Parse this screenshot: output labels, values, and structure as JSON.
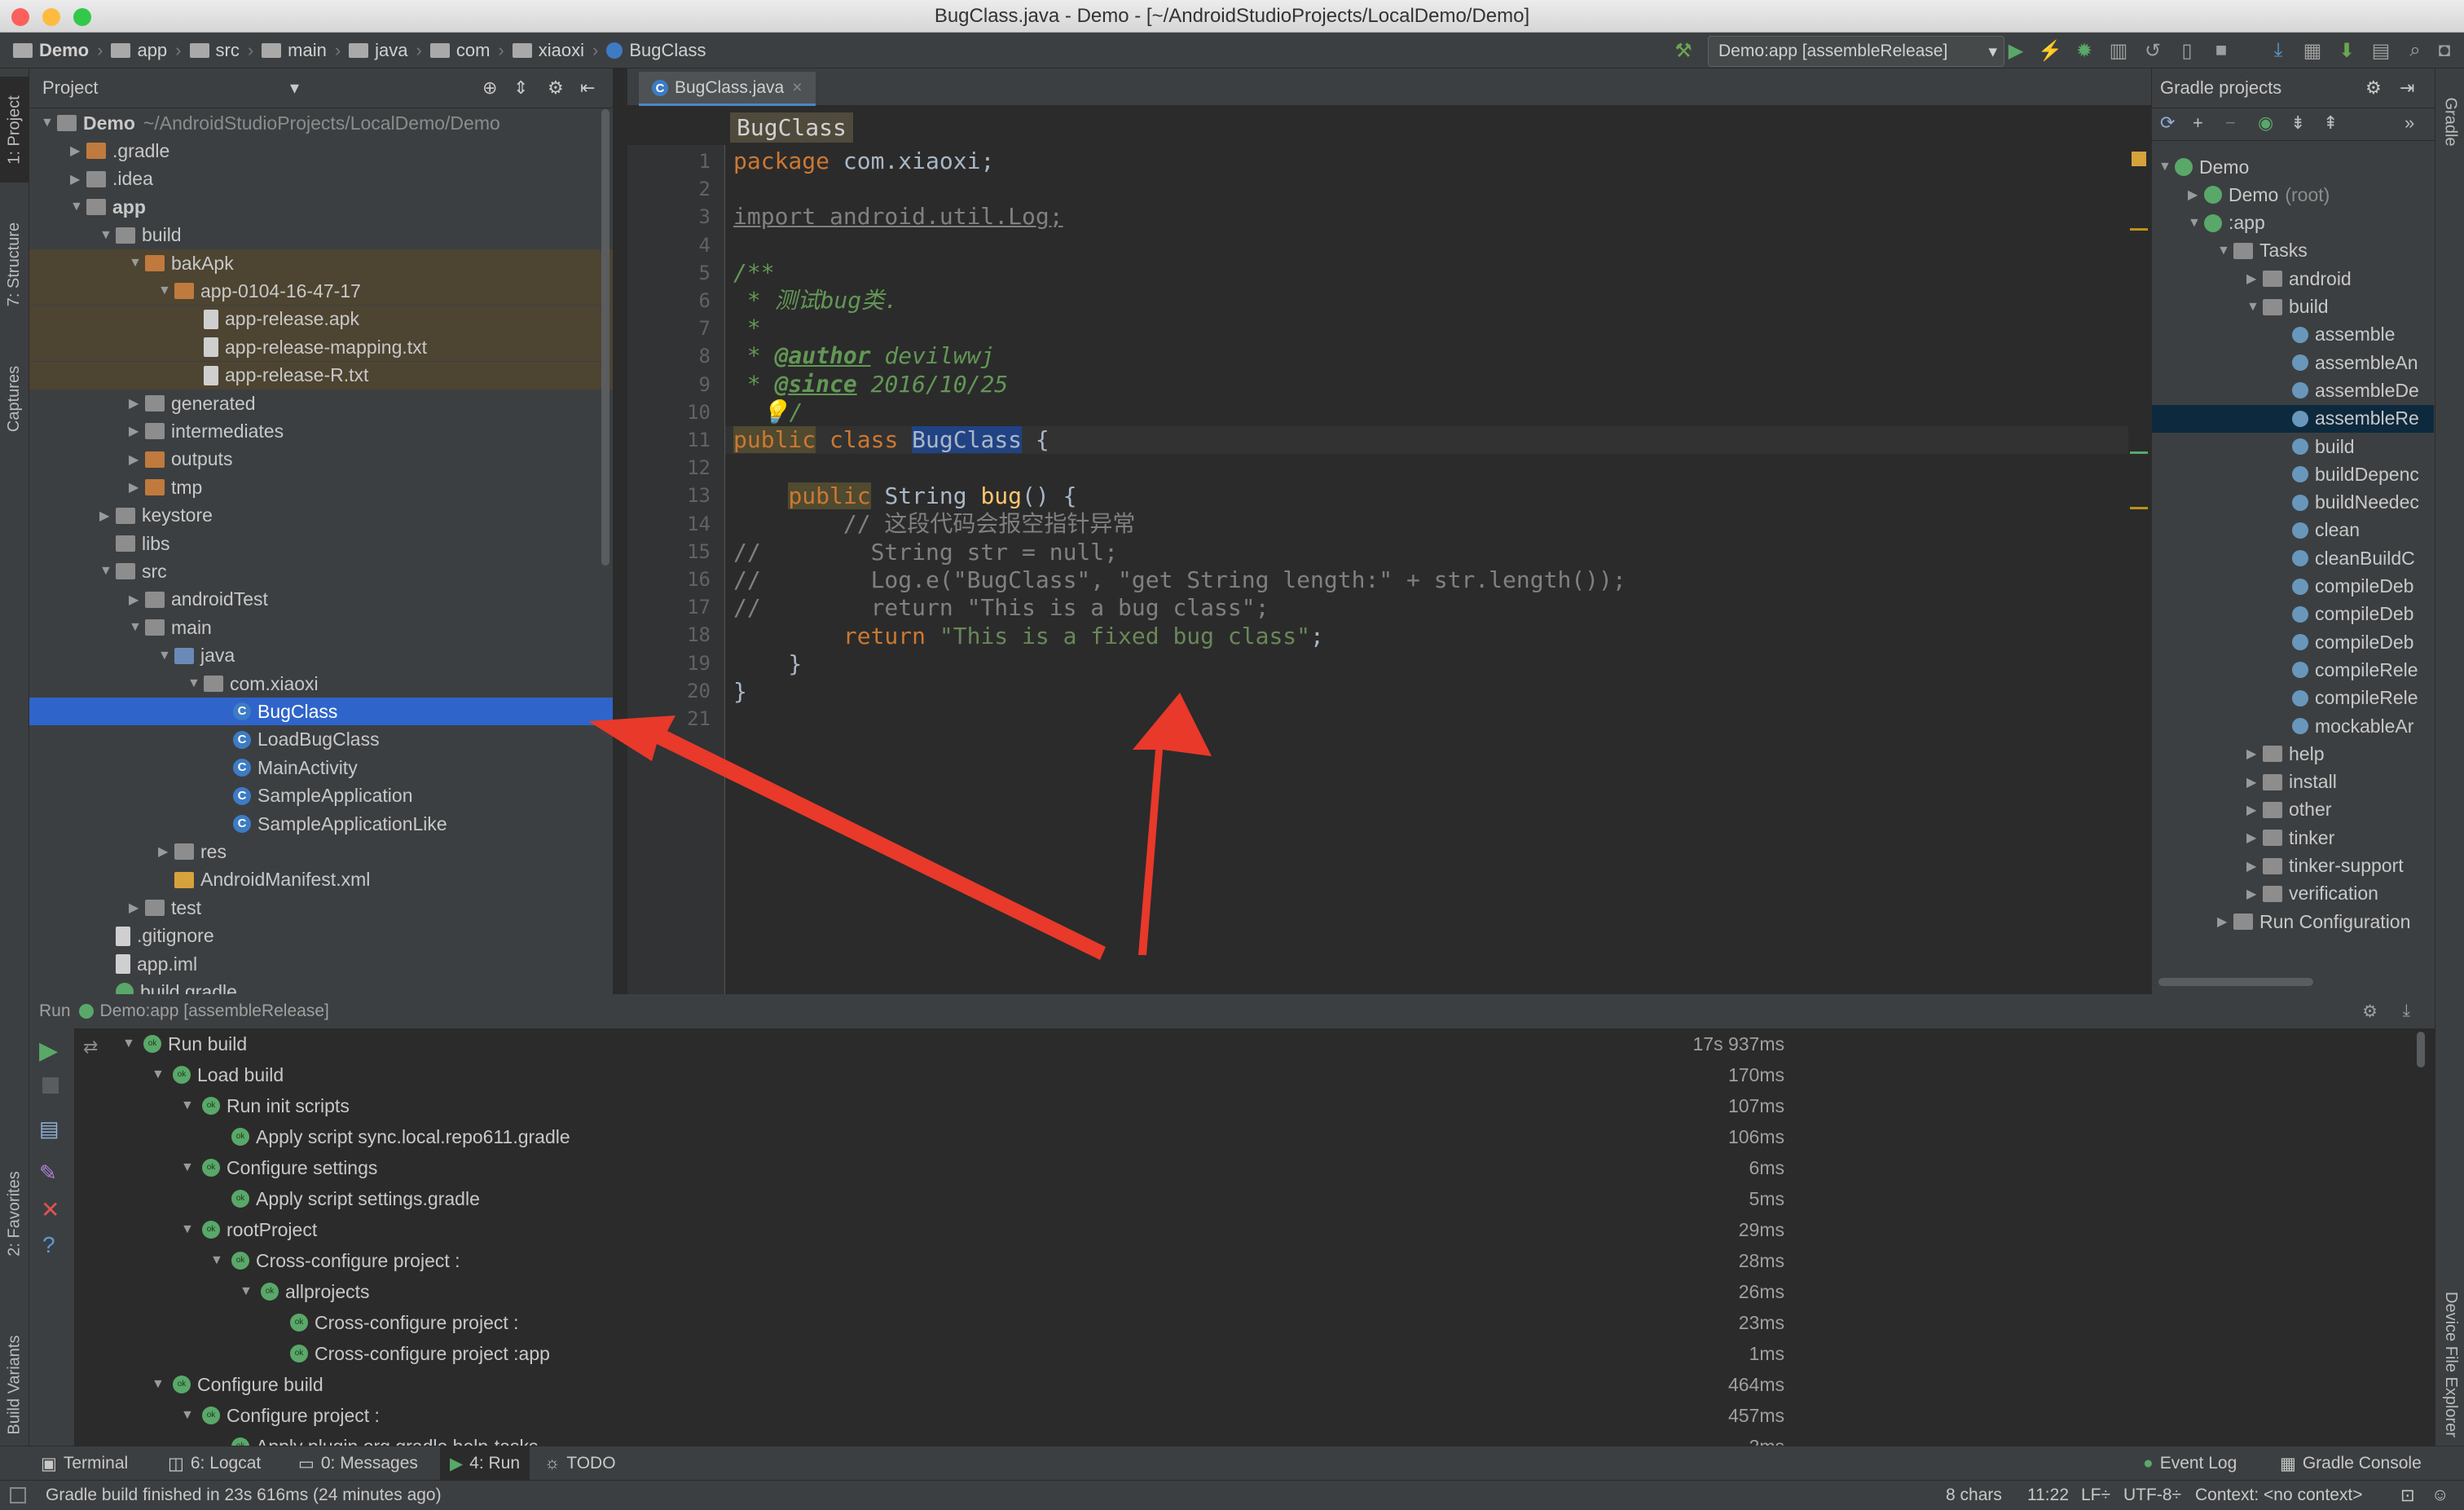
{
  "window": {
    "title": "BugClass.java - Demo - [~/AndroidStudioProjects/LocalDemo/Demo]"
  },
  "navbar": {
    "breadcrumbs": [
      "Demo",
      "app",
      "src",
      "main",
      "java",
      "com",
      "xiaoxi",
      "BugClass"
    ],
    "run_config": "Demo:app [assembleRelease]"
  },
  "left_strip": {
    "tabs": [
      "1: Project",
      "7: Structure",
      "Captures",
      "2: Favorites",
      "Build Variants"
    ]
  },
  "right_strip": {
    "tabs": [
      "Gradle",
      "Device File Explorer"
    ]
  },
  "project": {
    "header": "Project",
    "items": [
      {
        "label": "Demo",
        "suffix": "~/AndroidStudioProjects/LocalDemo/Demo",
        "depth": 0,
        "arrow": "▼",
        "icon": "folder"
      },
      {
        "label": ".gradle",
        "depth": 1,
        "arrow": "▶",
        "icon": "folder-o"
      },
      {
        "label": ".idea",
        "depth": 1,
        "arrow": "▶",
        "icon": "folder"
      },
      {
        "label": "app",
        "depth": 1,
        "arrow": "▼",
        "icon": "folder"
      },
      {
        "label": "build",
        "depth": 2,
        "arrow": "▼",
        "icon": "folder"
      },
      {
        "label": "bakApk",
        "depth": 3,
        "arrow": "▼",
        "icon": "folder-o"
      },
      {
        "label": "app-0104-16-47-17",
        "depth": 4,
        "arrow": "▼",
        "icon": "folder-o"
      },
      {
        "label": "app-release.apk",
        "depth": 5,
        "arrow": "",
        "icon": "file"
      },
      {
        "label": "app-release-mapping.txt",
        "depth": 5,
        "arrow": "",
        "icon": "file"
      },
      {
        "label": "app-release-R.txt",
        "depth": 5,
        "arrow": "",
        "icon": "file"
      },
      {
        "label": "generated",
        "depth": 3,
        "arrow": "▶",
        "icon": "folder"
      },
      {
        "label": "intermediates",
        "depth": 3,
        "arrow": "▶",
        "icon": "folder"
      },
      {
        "label": "outputs",
        "depth": 3,
        "arrow": "▶",
        "icon": "folder-o"
      },
      {
        "label": "tmp",
        "depth": 3,
        "arrow": "▶",
        "icon": "folder-o"
      },
      {
        "label": "keystore",
        "depth": 2,
        "arrow": "▶",
        "icon": "folder"
      },
      {
        "label": "libs",
        "depth": 2,
        "arrow": "",
        "icon": "folder"
      },
      {
        "label": "src",
        "depth": 2,
        "arrow": "▼",
        "icon": "folder"
      },
      {
        "label": "androidTest",
        "depth": 3,
        "arrow": "▶",
        "icon": "folder"
      },
      {
        "label": "main",
        "depth": 3,
        "arrow": "▼",
        "icon": "folder"
      },
      {
        "label": "java",
        "depth": 4,
        "arrow": "▼",
        "icon": "folder-b"
      },
      {
        "label": "com.xiaoxi",
        "depth": 5,
        "arrow": "▼",
        "icon": "folder"
      },
      {
        "label": "BugClass",
        "depth": 6,
        "arrow": "",
        "icon": "class",
        "selected": true
      },
      {
        "label": "LoadBugClass",
        "depth": 6,
        "arrow": "",
        "icon": "class"
      },
      {
        "label": "MainActivity",
        "depth": 6,
        "arrow": "",
        "icon": "class"
      },
      {
        "label": "SampleApplication",
        "depth": 6,
        "arrow": "",
        "icon": "class"
      },
      {
        "label": "SampleApplicationLike",
        "depth": 6,
        "arrow": "",
        "icon": "class"
      },
      {
        "label": "res",
        "depth": 4,
        "arrow": "▶",
        "icon": "folder"
      },
      {
        "label": "AndroidManifest.xml",
        "depth": 4,
        "arrow": "",
        "icon": "xml"
      },
      {
        "label": "test",
        "depth": 3,
        "arrow": "▶",
        "icon": "folder"
      },
      {
        "label": ".gitignore",
        "depth": 2,
        "arrow": "",
        "icon": "file"
      },
      {
        "label": "app.iml",
        "depth": 2,
        "arrow": "",
        "icon": "file"
      },
      {
        "label": "build.gradle",
        "depth": 2,
        "arrow": "",
        "icon": "gradle"
      }
    ]
  },
  "editor": {
    "tab": "BugClass.java",
    "context": "BugClass",
    "line_numbers": [
      "1",
      "2",
      "3",
      "4",
      "5",
      "6",
      "7",
      "8",
      "9",
      "10",
      "11",
      "12",
      "13",
      "14",
      "15",
      "16",
      "17",
      "18",
      "19",
      "20",
      "21"
    ]
  },
  "gradle_panel": {
    "header": "Gradle projects",
    "items": [
      {
        "label": "Demo",
        "suffix": "",
        "depth": 0,
        "arrow": "▼",
        "icon": "gradle"
      },
      {
        "label": "Demo",
        "suffix": "(root)",
        "depth": 1,
        "arrow": "▶",
        "icon": "gradle"
      },
      {
        "label": ":app",
        "suffix": "",
        "depth": 1,
        "arrow": "▼",
        "icon": "gradle"
      },
      {
        "label": "Tasks",
        "suffix": "",
        "depth": 2,
        "arrow": "▼",
        "icon": "folder"
      },
      {
        "label": "android",
        "suffix": "",
        "depth": 3,
        "arrow": "▶",
        "icon": "folder"
      },
      {
        "label": "build",
        "suffix": "",
        "depth": 3,
        "arrow": "▼",
        "icon": "folder"
      },
      {
        "label": "assemble",
        "suffix": "",
        "depth": 4,
        "arrow": "",
        "icon": "gear"
      },
      {
        "label": "assembleAn",
        "suffix": "",
        "depth": 4,
        "arrow": "",
        "icon": "gear"
      },
      {
        "label": "assembleDe",
        "suffix": "",
        "depth": 4,
        "arrow": "",
        "icon": "gear"
      },
      {
        "label": "assembleRe",
        "suffix": "",
        "depth": 4,
        "arrow": "",
        "icon": "gear",
        "selected": true
      },
      {
        "label": "build",
        "suffix": "",
        "depth": 4,
        "arrow": "",
        "icon": "gear"
      },
      {
        "label": "buildDepenc",
        "suffix": "",
        "depth": 4,
        "arrow": "",
        "icon": "gear"
      },
      {
        "label": "buildNeedec",
        "suffix": "",
        "depth": 4,
        "arrow": "",
        "icon": "gear"
      },
      {
        "label": "clean",
        "suffix": "",
        "depth": 4,
        "arrow": "",
        "icon": "gear"
      },
      {
        "label": "cleanBuildC",
        "suffix": "",
        "depth": 4,
        "arrow": "",
        "icon": "gear"
      },
      {
        "label": "compileDeb",
        "suffix": "",
        "depth": 4,
        "arrow": "",
        "icon": "gear"
      },
      {
        "label": "compileDeb",
        "suffix": "",
        "depth": 4,
        "arrow": "",
        "icon": "gear"
      },
      {
        "label": "compileDeb",
        "suffix": "",
        "depth": 4,
        "arrow": "",
        "icon": "gear"
      },
      {
        "label": "compileRele",
        "suffix": "",
        "depth": 4,
        "arrow": "",
        "icon": "gear"
      },
      {
        "label": "compileRele",
        "suffix": "",
        "depth": 4,
        "arrow": "",
        "icon": "gear"
      },
      {
        "label": "mockableAr",
        "suffix": "",
        "depth": 4,
        "arrow": "",
        "icon": "gear"
      },
      {
        "label": "help",
        "suffix": "",
        "depth": 3,
        "arrow": "▶",
        "icon": "folder"
      },
      {
        "label": "install",
        "suffix": "",
        "depth": 3,
        "arrow": "▶",
        "icon": "folder"
      },
      {
        "label": "other",
        "suffix": "",
        "depth": 3,
        "arrow": "▶",
        "icon": "folder"
      },
      {
        "label": "tinker",
        "suffix": "",
        "depth": 3,
        "arrow": "▶",
        "icon": "folder"
      },
      {
        "label": "tinker-support",
        "suffix": "",
        "depth": 3,
        "arrow": "▶",
        "icon": "folder"
      },
      {
        "label": "verification",
        "suffix": "",
        "depth": 3,
        "arrow": "▶",
        "icon": "folder"
      },
      {
        "label": "Run Configuration",
        "suffix": "",
        "depth": 2,
        "arrow": "▶",
        "icon": "folder"
      }
    ]
  },
  "run_panel": {
    "header": "Run",
    "config": "Demo:app [assembleRelease]",
    "rows": [
      {
        "label": "Run build",
        "depth": 0,
        "arrow": "▼",
        "time": "17s 937ms"
      },
      {
        "label": "Load build",
        "depth": 1,
        "arrow": "▼",
        "time": "170ms"
      },
      {
        "label": "Run init scripts",
        "depth": 2,
        "arrow": "▼",
        "time": "107ms"
      },
      {
        "label": "Apply script sync.local.repo611.gradle",
        "depth": 3,
        "arrow": "",
        "time": "106ms"
      },
      {
        "label": "Configure settings",
        "depth": 2,
        "arrow": "▼",
        "time": "6ms"
      },
      {
        "label": "Apply script settings.gradle",
        "depth": 3,
        "arrow": "",
        "time": "5ms"
      },
      {
        "label": "rootProject",
        "depth": 2,
        "arrow": "▼",
        "time": "29ms"
      },
      {
        "label": "Cross-configure project :",
        "depth": 3,
        "arrow": "▼",
        "time": "28ms"
      },
      {
        "label": "allprojects",
        "depth": 4,
        "arrow": "▼",
        "time": "26ms"
      },
      {
        "label": "Cross-configure project :",
        "depth": 5,
        "arrow": "",
        "time": "23ms"
      },
      {
        "label": "Cross-configure project :app",
        "depth": 5,
        "arrow": "",
        "time": "1ms"
      },
      {
        "label": "Configure build",
        "depth": 1,
        "arrow": "▼",
        "time": "464ms"
      },
      {
        "label": "Configure project :",
        "depth": 2,
        "arrow": "▼",
        "time": "457ms"
      },
      {
        "label": "Apply plugin org.gradle.help-tasks",
        "depth": 3,
        "arrow": "",
        "time": "2ms"
      }
    ]
  },
  "bottom_tabs": {
    "terminal": "Terminal",
    "logcat": "6: Logcat",
    "messages": "0: Messages",
    "run": "4: Run",
    "todo": "TODO",
    "event_log": "Event Log",
    "gradle_console": "Gradle Console"
  },
  "status_bar": {
    "message": "Gradle build finished in 23s 616ms (24 minutes ago)",
    "chars": "8 chars",
    "position": "11:22",
    "line_sep": "LF÷",
    "encoding": "UTF-8÷",
    "context": "Context: <no context>"
  },
  "colors": {
    "accent": "#2f65ca",
    "arrow": "#e8392a",
    "keyword": "#cc7832",
    "string": "#6a8759",
    "doc": "#629755"
  }
}
